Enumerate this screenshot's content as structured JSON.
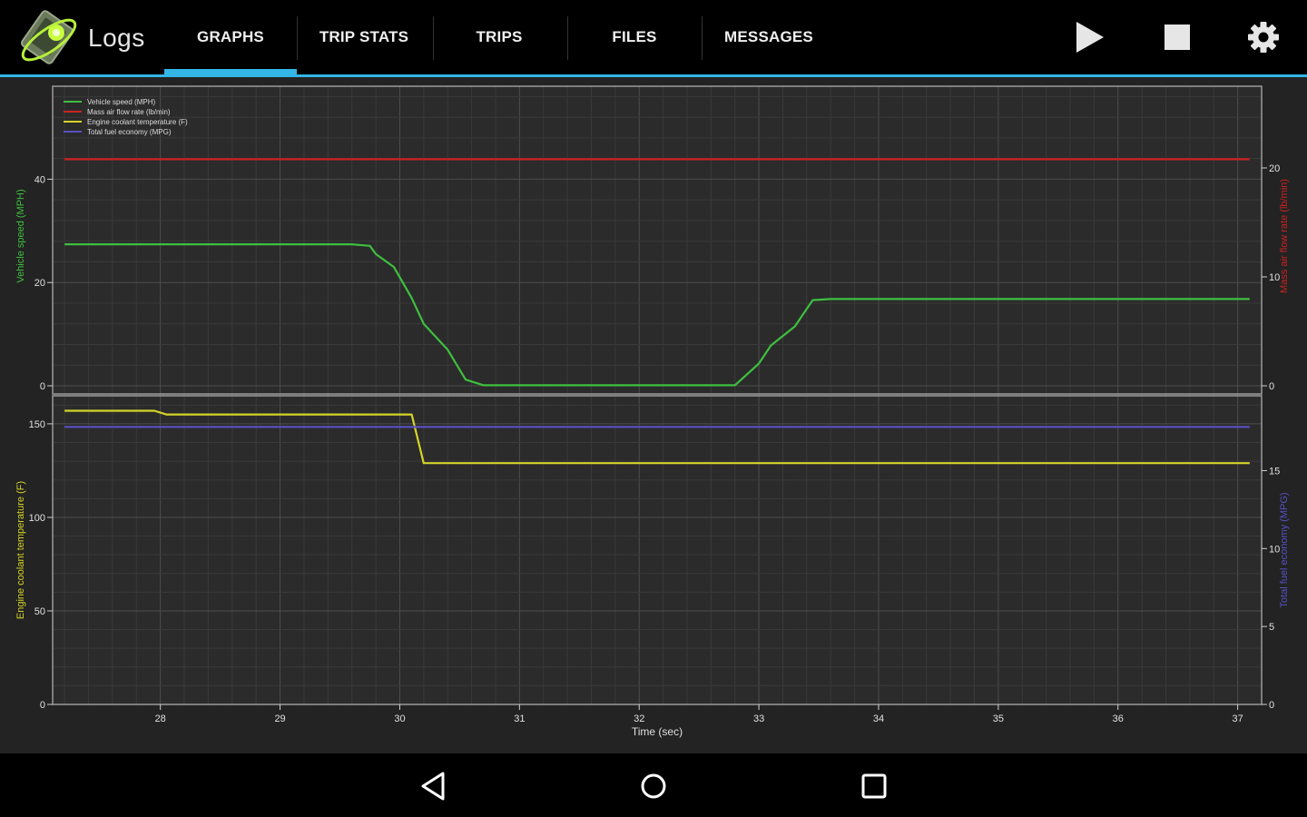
{
  "app": {
    "title": "Logs"
  },
  "tabs": [
    {
      "label": "GRAPHS",
      "active": true
    },
    {
      "label": "TRIP STATS",
      "active": false
    },
    {
      "label": "TRIPS",
      "active": false
    },
    {
      "label": "FILES",
      "active": false
    },
    {
      "label": "MESSAGES",
      "active": false
    }
  ],
  "actions": [
    {
      "icon": "play-icon"
    },
    {
      "icon": "stop-icon"
    },
    {
      "icon": "gear-icon"
    }
  ],
  "nav": [
    {
      "icon": "back-icon"
    },
    {
      "icon": "home-icon"
    },
    {
      "icon": "recents-icon"
    }
  ],
  "colors": {
    "accent": "#33b5e5",
    "speed": "#3fbf3f",
    "maf": "#cc2222",
    "coolant": "#d4d42a",
    "fuel": "#5a4fc4"
  },
  "chart_data": {
    "type": "line",
    "xlabel": "Time (sec)",
    "xlim": [
      27.1,
      37.2
    ],
    "x_ticks": [
      28,
      29,
      30,
      31,
      32,
      33,
      34,
      35,
      36,
      37
    ],
    "legend": [
      {
        "name": "Vehicle speed (MPH)",
        "color": "#3fbf3f"
      },
      {
        "name": "Mass air flow rate (lb/min)",
        "color": "#cc2222"
      },
      {
        "name": "Engine coolant temperature (F)",
        "color": "#d4d42a"
      },
      {
        "name": "Total fuel economy (MPG)",
        "color": "#5a4fc4"
      }
    ],
    "legend_position": "top-left",
    "grid": true,
    "panels": [
      {
        "left_axis": {
          "label": "Vehicle speed (MPH)",
          "range": [
            0,
            58
          ],
          "ticks": [
            0,
            20,
            40
          ],
          "color": "#3fbf3f"
        },
        "right_axis": {
          "label": "Mass air flow rate (lb/min)",
          "range": [
            0,
            27.5
          ],
          "ticks": [
            0,
            10,
            20
          ],
          "color": "#cc2222"
        },
        "series": [
          {
            "name": "Vehicle speed (MPH)",
            "axis": "left",
            "color": "#3fbf3f",
            "points": [
              [
                27.2,
                27.4
              ],
              [
                29.6,
                27.4
              ],
              [
                29.75,
                27.1
              ],
              [
                29.8,
                25.5
              ],
              [
                29.95,
                23
              ],
              [
                30.1,
                17
              ],
              [
                30.2,
                12
              ],
              [
                30.4,
                7
              ],
              [
                30.55,
                1.2
              ],
              [
                30.7,
                0.1
              ],
              [
                32.8,
                0.1
              ],
              [
                33.0,
                4.3
              ],
              [
                33.1,
                7.8
              ],
              [
                33.3,
                11.5
              ],
              [
                33.45,
                16.6
              ],
              [
                33.6,
                16.8
              ],
              [
                37.1,
                16.8
              ]
            ]
          },
          {
            "name": "Mass air flow rate (lb/min)",
            "axis": "right",
            "color": "#cc2222",
            "points": [
              [
                27.2,
                20.8
              ],
              [
                37.1,
                20.8
              ]
            ]
          }
        ]
      },
      {
        "left_axis": {
          "label": "Engine coolant temperature (F)",
          "range": [
            0,
            165
          ],
          "ticks": [
            0,
            50,
            100,
            150
          ],
          "color": "#d4d42a"
        },
        "right_axis": {
          "label": "Total fuel economy (MPG)",
          "range": [
            0,
            19.8
          ],
          "ticks": [
            0,
            5,
            10,
            15
          ],
          "color": "#5a4fc4"
        },
        "series": [
          {
            "name": "Engine coolant temperature (F)",
            "axis": "left",
            "color": "#d4d42a",
            "points": [
              [
                27.2,
                157
              ],
              [
                27.95,
                157
              ],
              [
                28.05,
                155
              ],
              [
                30.1,
                155
              ],
              [
                30.2,
                129
              ],
              [
                37.1,
                129
              ]
            ]
          },
          {
            "name": "Total fuel economy (MPG)",
            "axis": "right",
            "color": "#5a4fc4",
            "points": [
              [
                27.2,
                17.8
              ],
              [
                37.1,
                17.8
              ]
            ]
          }
        ]
      }
    ]
  }
}
